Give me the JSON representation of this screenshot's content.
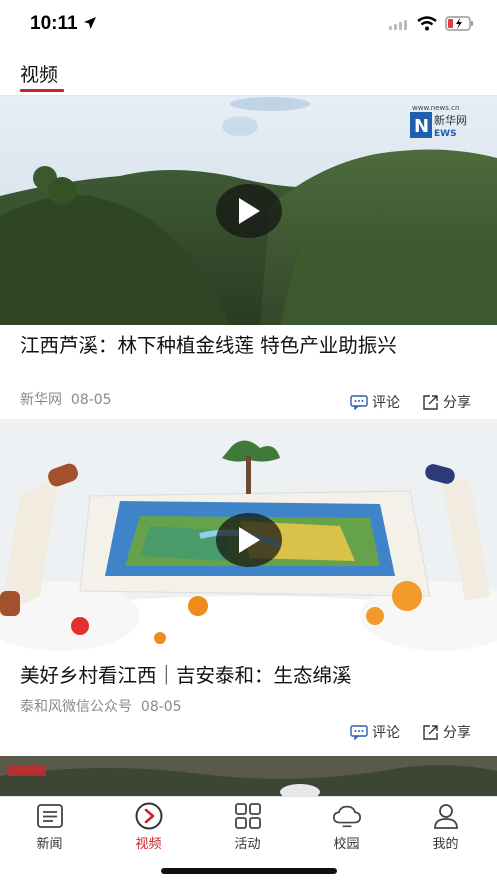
{
  "status_bar": {
    "time": "10:11"
  },
  "header": {
    "tab_label": "视频"
  },
  "feed": {
    "items": [
      {
        "title": "江西芦溪：林下种植金线莲 特色产业助振兴",
        "source": "新华网",
        "date": "08-05",
        "watermark_text": "新华网",
        "watermark_url": "www.news.cn",
        "comment_label": "评论",
        "share_label": "分享"
      },
      {
        "title": "美好乡村看江西｜吉安泰和：生态绵溪",
        "source": "泰和风微信公众号",
        "date": "08-05",
        "comment_label": "评论",
        "share_label": "分享"
      }
    ]
  },
  "tabbar": {
    "tabs": [
      {
        "label": "新闻",
        "icon": "news-icon"
      },
      {
        "label": "视频",
        "icon": "video-icon",
        "active": true
      },
      {
        "label": "活动",
        "icon": "grid-icon"
      },
      {
        "label": "校园",
        "icon": "cloud-icon"
      },
      {
        "label": "我的",
        "icon": "user-icon"
      }
    ]
  },
  "colors": {
    "accent": "#c8252c",
    "background": "#f2f2f2",
    "meta_text": "#8a8a8a",
    "action_icon": "#2b5fb4"
  }
}
